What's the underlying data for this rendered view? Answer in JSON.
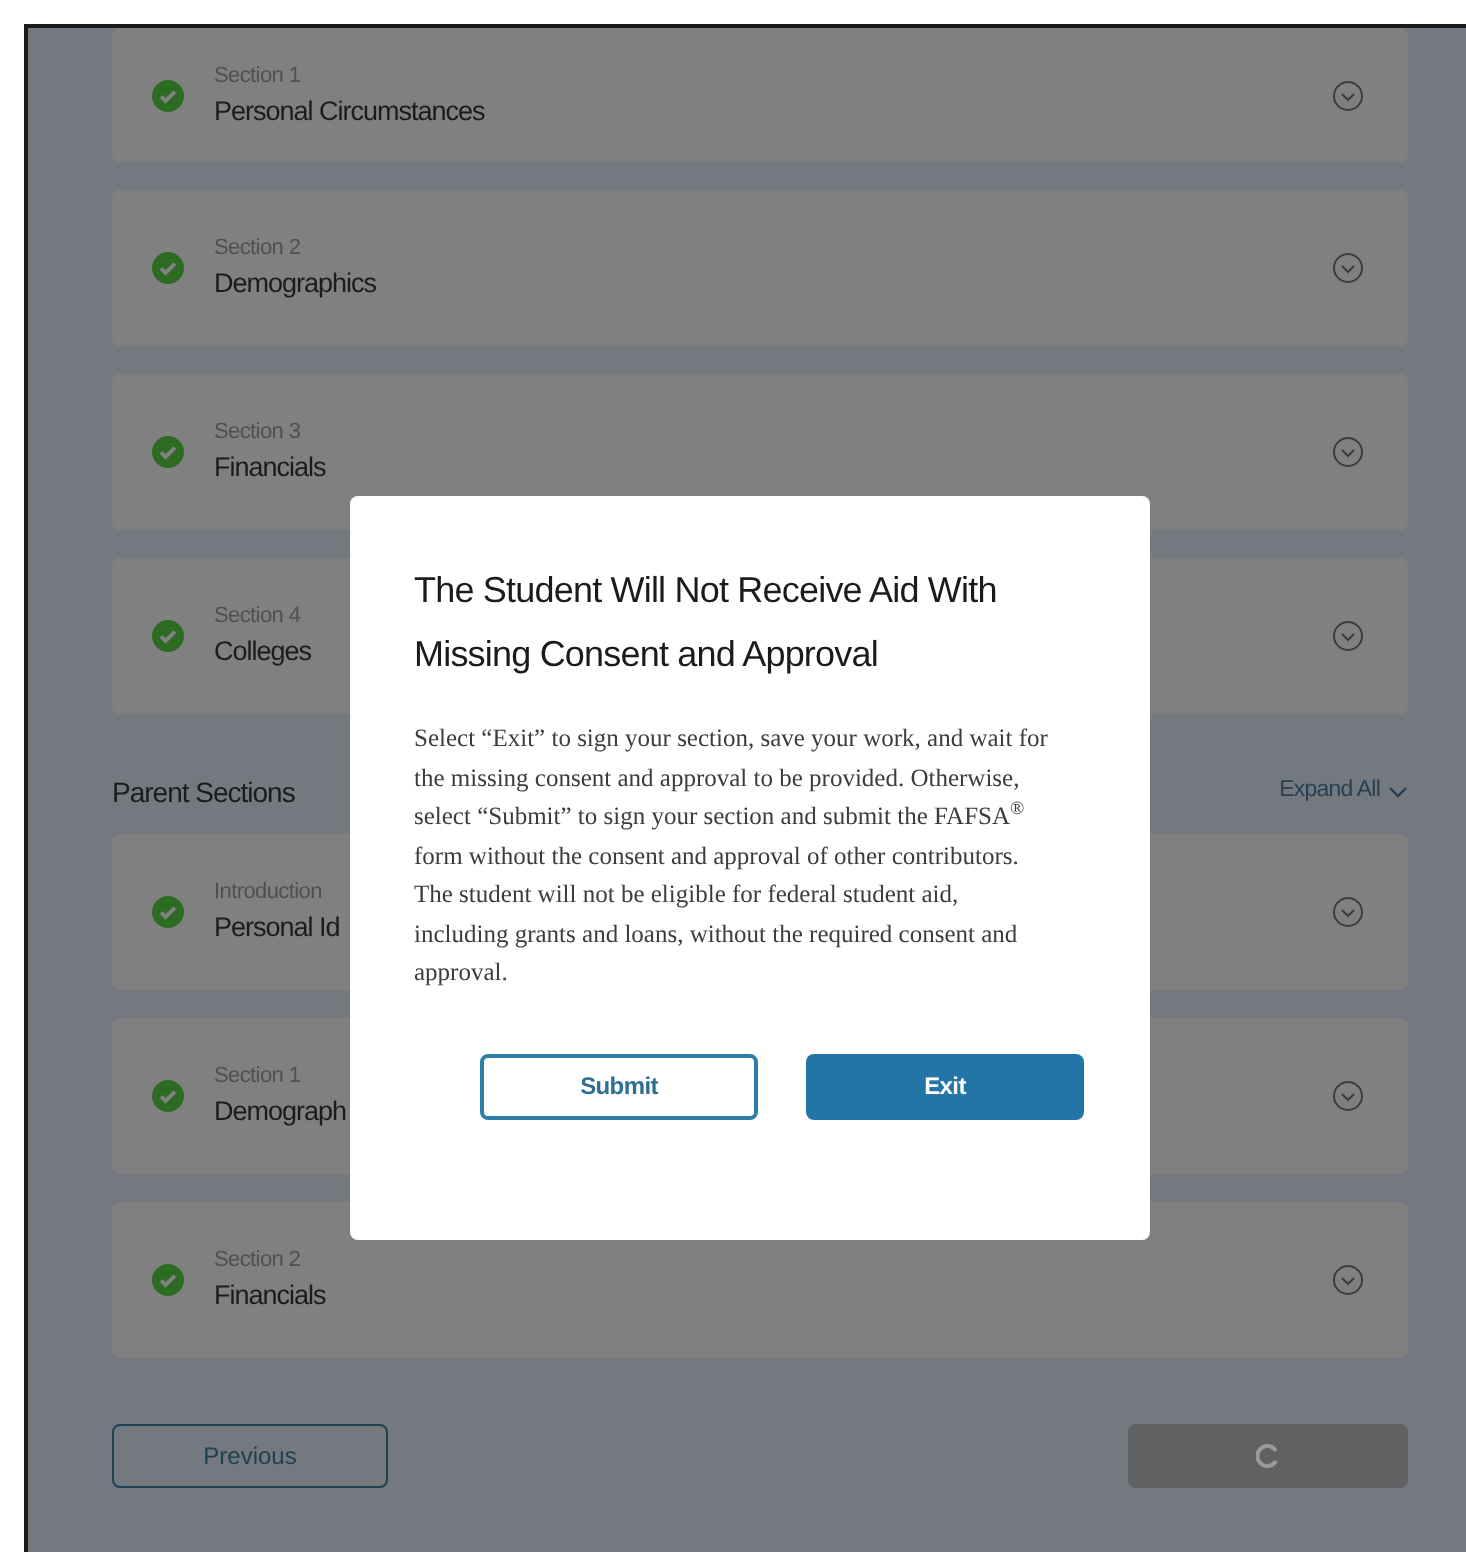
{
  "student_sections": [
    {
      "label": "Section 1",
      "title": "Personal Circumstances",
      "complete": true
    },
    {
      "label": "Section 2",
      "title": "Demographics",
      "complete": true
    },
    {
      "label": "Section 3",
      "title": "Financials",
      "complete": true
    },
    {
      "label": "Section 4",
      "title": "Colleges",
      "complete": true
    }
  ],
  "parent_heading": "Parent Sections",
  "expand_all": "Expand All",
  "parent_sections": [
    {
      "label": "Introduction",
      "title": "Personal Id",
      "complete": true
    },
    {
      "label": "Section 1",
      "title": "Demograph",
      "complete": true
    },
    {
      "label": "Section 2",
      "title": "Financials",
      "complete": true
    }
  ],
  "previous_button": "Previous",
  "next_button": {
    "loading": true
  },
  "modal": {
    "title": "The Student Will Not Receive Aid With Missing Consent and Approval",
    "body": "Select “Exit” to sign your section, save your work, and wait for the missing consent and approval to be provided. Otherwise, select “Submit” to sign your section and submit the FAFSA$^{®}$ form without the consent and approval of other contributors. The student will not be eligible for federal student aid, including grants and loans, without the required consent and approval.",
    "buttons": [
      {
        "label": "Submit",
        "kind": "secondary"
      },
      {
        "label": "Exit",
        "kind": "primary"
      }
    ]
  }
}
